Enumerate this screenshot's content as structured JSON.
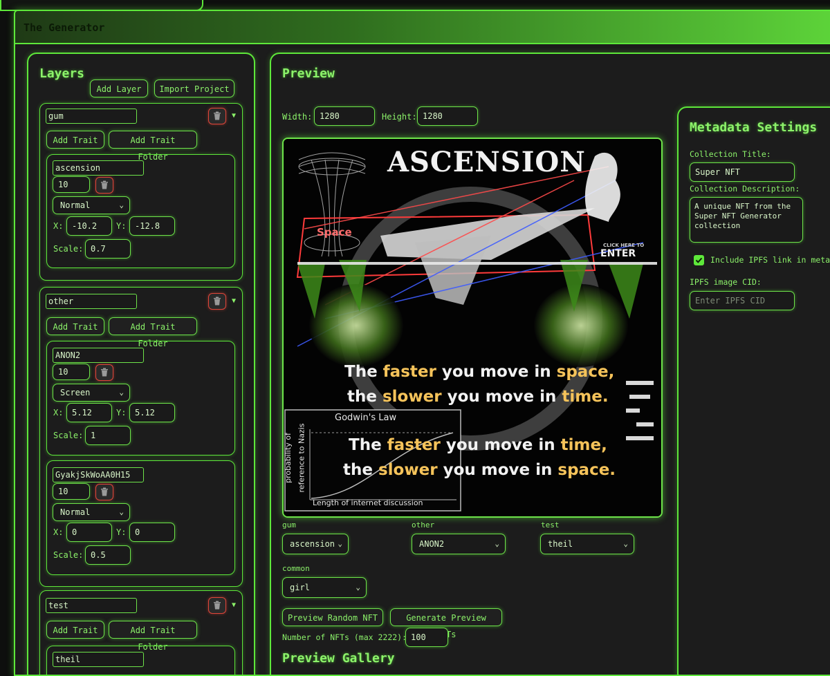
{
  "app": {
    "title": "The Generator"
  },
  "layers_panel": {
    "heading": "Layers",
    "add_layer": "Add Layer",
    "import_project": "Import Project",
    "add_trait": "Add Trait",
    "add_trait_folder": "Add Trait Folder",
    "x_label": "X:",
    "y_label": "Y:",
    "scale_label": "Scale:",
    "layers": [
      {
        "name": "gum",
        "traits": [
          {
            "name": "ascension",
            "weight": "10",
            "blend": "Normal",
            "x": "-10.2",
            "y": "-12.8",
            "scale": "0.7"
          }
        ]
      },
      {
        "name": "other",
        "traits": [
          {
            "name": "ANON2",
            "weight": "10",
            "blend": "Screen",
            "x": "5.12",
            "y": "5.12",
            "scale": "1"
          },
          {
            "name": "GyakjSkWoAA0H15",
            "weight": "10",
            "blend": "Normal",
            "x": "0",
            "y": "0",
            "scale": "0.5"
          }
        ]
      },
      {
        "name": "test",
        "traits": [
          {
            "name": "theil"
          }
        ]
      }
    ]
  },
  "preview_panel": {
    "heading": "Preview",
    "width_label": "Width:",
    "width_value": "1280",
    "height_label": "Height:",
    "height_value": "1280",
    "image_text": {
      "title": "ASCENSION",
      "space_label": "Space",
      "enter_small": "CLICK HERE TO",
      "enter": "ENTER",
      "line1_a": "The ",
      "line1_b": "faster",
      "line1_c": " you move in ",
      "line1_d": "space,",
      "line2_a": "the ",
      "line2_b": "slower",
      "line2_c": " you move in ",
      "line2_d": "time.",
      "line3_a": "The ",
      "line3_b": "faster",
      "line3_c": " you move in ",
      "line3_d": "time,",
      "line4_a": "the ",
      "line4_b": "slower",
      "line4_c": " you move in ",
      "line4_d": "space.",
      "inset_title": "Godwin's Law",
      "inset_ylabel_1": "probability of",
      "inset_ylabel_2": "reference to Nazis",
      "inset_xlabel": "Length of internet discussion"
    },
    "selectors": [
      {
        "label": "gum",
        "value": "ascension"
      },
      {
        "label": "other",
        "value": "ANON2"
      },
      {
        "label": "test",
        "value": "theil"
      },
      {
        "label": "common",
        "value": "girl"
      }
    ],
    "preview_random": "Preview Random NFT",
    "generate_preview": "Generate Preview NFTs",
    "num_label": "Number of NFTs (max 2222):",
    "num_value": "100",
    "gallery_heading": "Preview Gallery"
  },
  "metadata_panel": {
    "heading": "Metadata Settings",
    "collection_title_label": "Collection Title:",
    "collection_title_value": "Super NFT",
    "collection_desc_label": "Collection Description:",
    "collection_desc_value": "A unique NFT from the Super NFT Generator collection",
    "ipfs_checkbox_label": "Include IPFS link in metadata",
    "ipfs_checked": true,
    "ipfs_cid_label": "IPFS image CID:",
    "ipfs_cid_placeholder": "Enter IPFS CID"
  },
  "colors": {
    "accent": "#5ee83a",
    "text": "#8cf26a",
    "danger": "#e0463a",
    "background": "#1c1c1c"
  },
  "icons": {
    "delete": "trash-icon",
    "expand": "triangle-down-icon",
    "dropdown": "chevron-down-icon",
    "check": "check-icon"
  }
}
